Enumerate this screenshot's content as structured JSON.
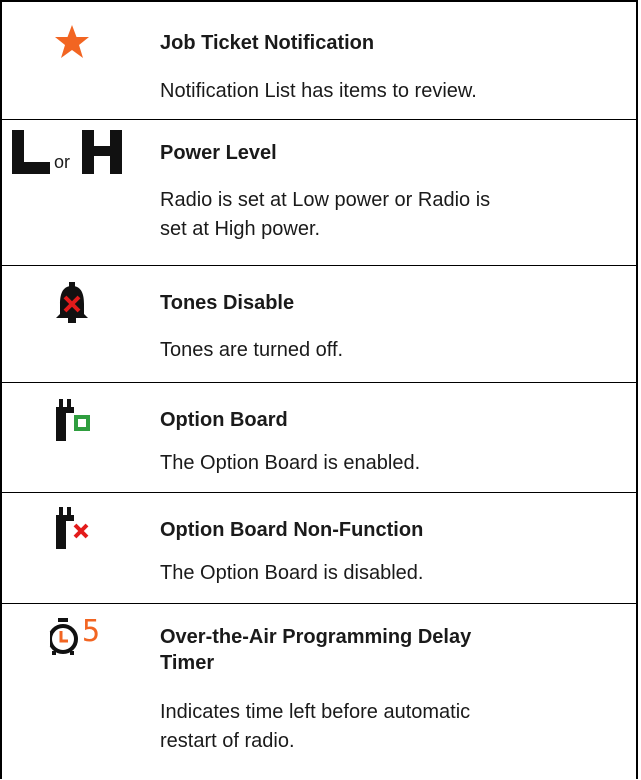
{
  "colors": {
    "orange": "#f26522",
    "green": "#2f9e3f",
    "red": "#e31b1b",
    "black": "#111111"
  },
  "rows": [
    {
      "icon": "orange-star-icon",
      "title": "Job Ticket Notification",
      "desc_lines": [
        "Notification List has items to review."
      ]
    },
    {
      "icon": "power-level-icons",
      "or_text": "or",
      "title": "Power Level",
      "desc_lines": [
        "Radio is set at Low power or Radio is",
        "set at High power."
      ]
    },
    {
      "icon": "bell-x-icon",
      "title": "Tones Disable",
      "desc_lines": [
        "Tones are turned off."
      ]
    },
    {
      "icon": "option-board-enabled-icon",
      "title": "Option Board",
      "desc_lines": [
        "The Option Board is enabled."
      ]
    },
    {
      "icon": "option-board-disabled-icon",
      "title": "Option Board Non-Function",
      "desc_lines": [
        "The Option Board is disabled."
      ]
    },
    {
      "icon": "ota-timer-icon",
      "icon_digit": "5",
      "title_lines": [
        "Over-the-Air Programming Delay",
        "Timer"
      ],
      "desc_lines": [
        "Indicates time left before automatic",
        "restart of radio."
      ]
    }
  ]
}
